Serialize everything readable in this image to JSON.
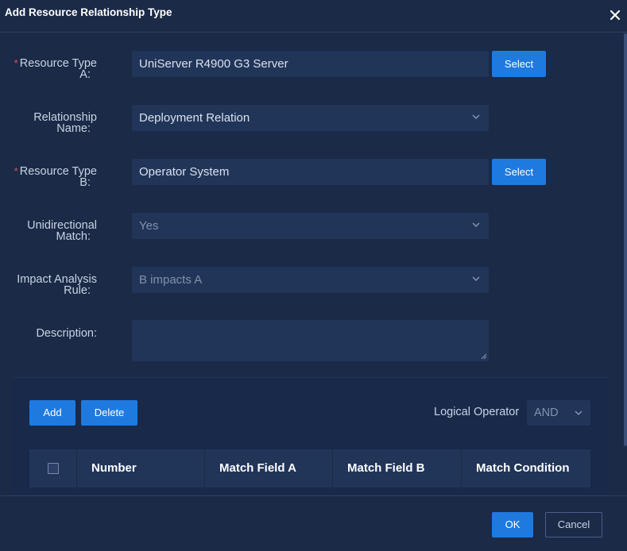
{
  "dialog": {
    "title": "Add Resource Relationship Type"
  },
  "form": {
    "resource_type_a": {
      "label_line1": "Resource Type",
      "label_line2": "A:",
      "value": "UniServer R4900 G3 Server",
      "required_mark": "*",
      "button": "Select"
    },
    "relationship_name": {
      "label_line1": "Relationship",
      "label_line2": "Name:",
      "value": "Deployment Relation"
    },
    "resource_type_b": {
      "label_line1": "Resource Type",
      "label_line2": "B:",
      "value": "Operator System",
      "required_mark": "*",
      "button": "Select"
    },
    "unidirectional_match": {
      "label_line1": "Unidirectional",
      "label_line2": "Match:",
      "value": "Yes"
    },
    "impact_analysis_rule": {
      "label_line1": "Impact Analysis",
      "label_line2": "Rule:",
      "value": "B impacts A"
    },
    "description": {
      "label": "Description:",
      "value": ""
    }
  },
  "match_panel": {
    "add_label": "Add",
    "delete_label": "Delete",
    "logical_operator_label": "Logical Operator",
    "logical_operator_value": "AND",
    "columns": [
      "Number",
      "Match Field A",
      "Match Field B",
      "Match Condition"
    ]
  },
  "footer": {
    "ok_label": "OK",
    "cancel_label": "Cancel"
  },
  "colors": {
    "background": "#1a2a47",
    "field": "#213559",
    "primary": "#1f7ae0",
    "required": "#e34d59"
  },
  "icons": {
    "close": "close-icon",
    "dropdown": "chevron-down-icon",
    "resize": "resize-handle-icon"
  }
}
